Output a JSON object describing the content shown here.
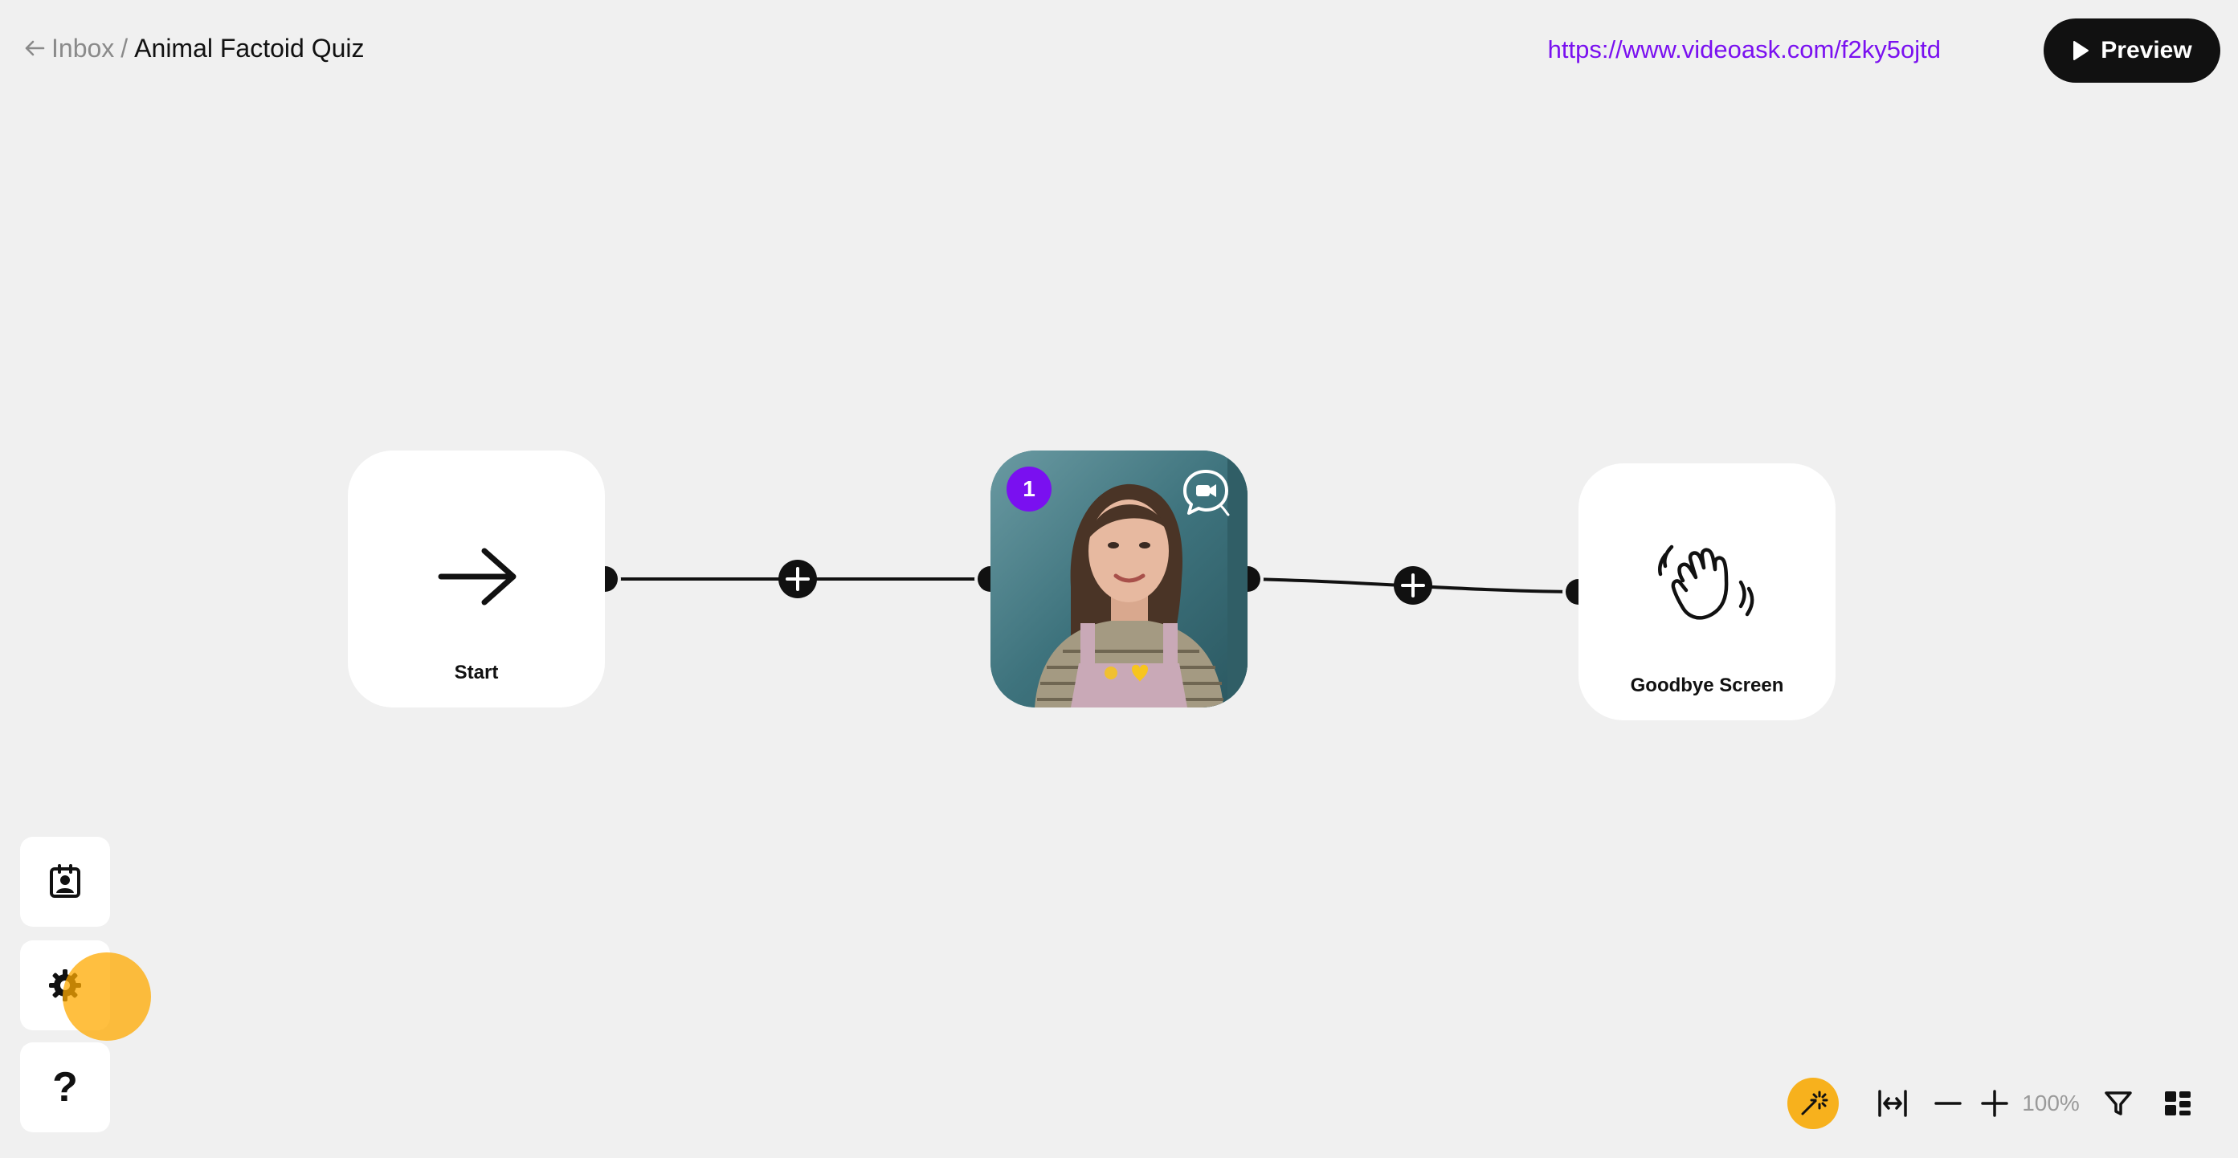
{
  "header": {
    "back_label": "Inbox",
    "separator": "/",
    "title": "Animal Factoid Quiz",
    "share_url": "https://www.videoask.com/f2ky5ojtd",
    "preview_label": "Preview"
  },
  "flow": {
    "start_node": {
      "label": "Start",
      "icon": "arrow-right-icon"
    },
    "video_node": {
      "step_number": "1",
      "badge_color": "#7a10f0",
      "icon": "video-response-icon"
    },
    "end_node": {
      "label": "Goodbye Screen",
      "icon": "waving-hand-icon"
    }
  },
  "sidebar": {
    "items": [
      {
        "name": "contacts",
        "icon": "contact-card-icon"
      },
      {
        "name": "settings",
        "icon": "gear-icon"
      },
      {
        "name": "help",
        "label": "?",
        "icon": "question-icon"
      }
    ]
  },
  "toolbar": {
    "zoom": "100%",
    "items": [
      "magic-wand-icon",
      "fit-width-icon",
      "zoom-out-icon",
      "zoom-in-icon",
      "filter-icon",
      "layout-icon"
    ]
  },
  "colors": {
    "accent": "#7a10f0",
    "canvas": "#f0f0f0",
    "highlight": "#f7b11d"
  }
}
